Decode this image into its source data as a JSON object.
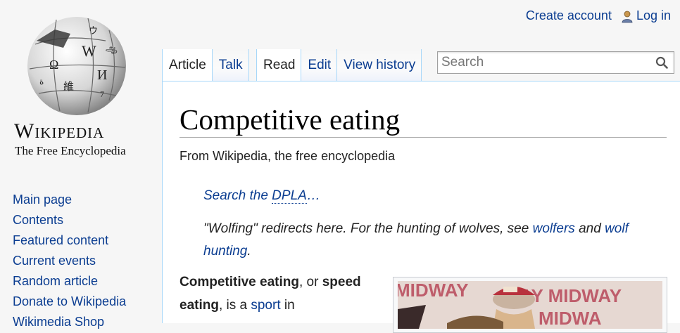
{
  "personal": {
    "create_account": "Create account",
    "log_in": "Log in",
    "user_icon": "user-icon"
  },
  "logo": {
    "wordmark": "Wikipedia",
    "tagline": "The Free Encyclopedia",
    "icon": "puzzle-globe-logo"
  },
  "nav": {
    "items": [
      "Main page",
      "Contents",
      "Featured content",
      "Current events",
      "Random article",
      "Donate to Wikipedia",
      "Wikimedia Shop"
    ]
  },
  "tabs": {
    "article": "Article",
    "talk": "Talk",
    "read": "Read",
    "edit": "Edit",
    "view_history": "View history"
  },
  "search": {
    "placeholder": "Search",
    "icon": "search-icon"
  },
  "article": {
    "title": "Competitive eating",
    "site_sub": "From Wikipedia, the free encyclopedia",
    "dpla_prefix": "Search the ",
    "dpla_link": "DPLA",
    "dpla_suffix": "…",
    "redirect_text": "\"Wolfing\" redirects here. For the hunting of wolves, see ",
    "redirect_link1": "wolfers",
    "redirect_and": " and ",
    "redirect_link2": "wolf hunting",
    "redirect_end": ".",
    "lead_bold1": "Competitive eating",
    "lead_text1": ", or ",
    "lead_bold2": "speed eating",
    "lead_text2": ", is a ",
    "lead_link": "sport",
    "lead_text3": " in"
  },
  "colors": {
    "link": "#0b3d91",
    "tab_border": "#a7d7f9",
    "page_bg": "#f6f6f6"
  }
}
